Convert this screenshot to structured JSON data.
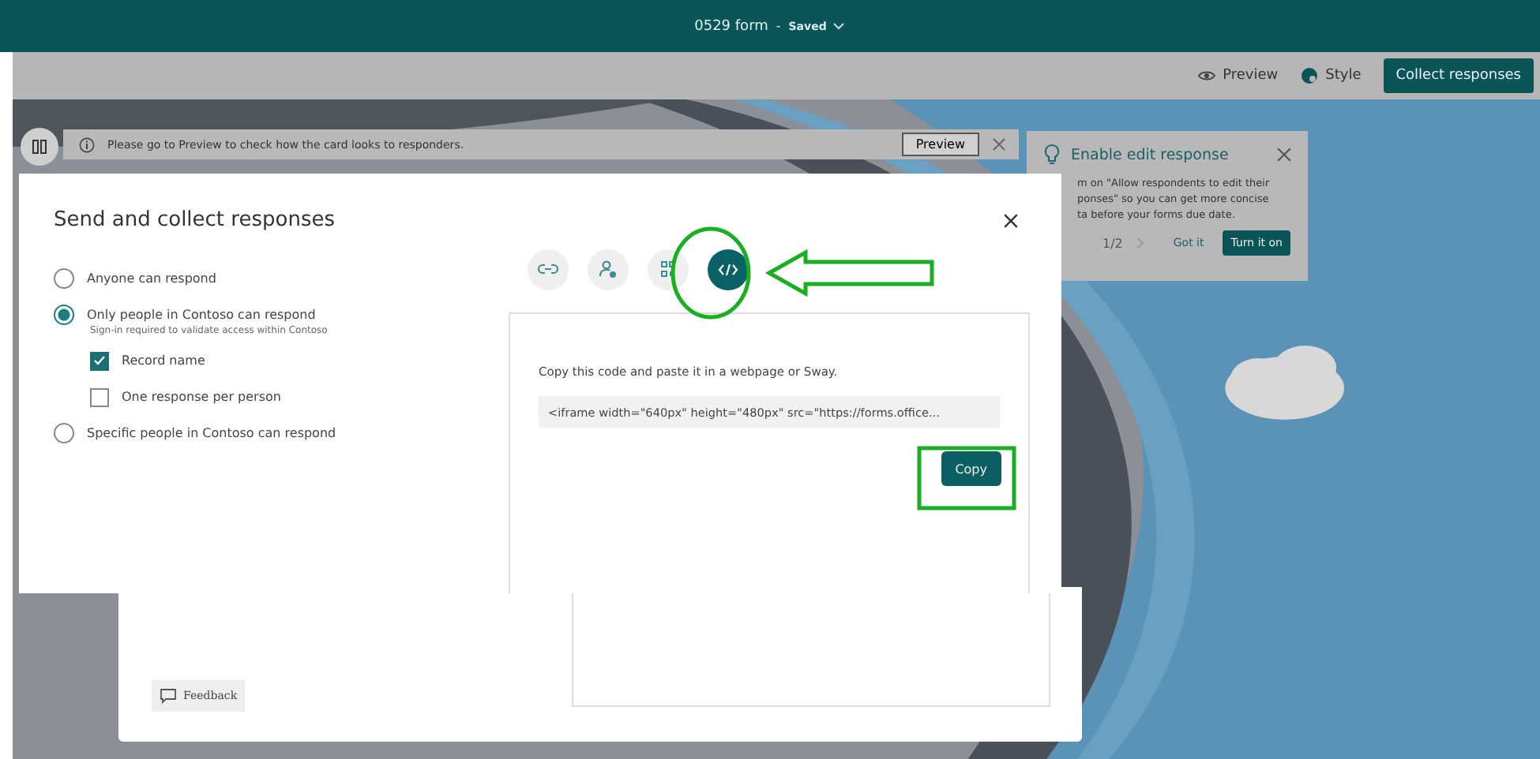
{
  "title_bar": {
    "form_name": "0529 form",
    "separator": "-",
    "status": "Saved"
  },
  "toolbar": {
    "buttons": [
      {
        "label": "Preview",
        "kind": "preview"
      },
      {
        "label": "Style",
        "kind": "style"
      },
      {
        "label": "Collect responses",
        "kind": "primary"
      }
    ]
  },
  "notice_bar": {
    "message": "Please go to Preview to check how the card looks to responders.",
    "button": "Preview"
  },
  "teaching_popup": {
    "title": "Enable edit response",
    "lines": [
      "m on \"Allow respondents to edit their",
      "ponses\" so you can get more concise",
      "ta before your forms due date."
    ],
    "pager": "1/2",
    "secondary": "Got it",
    "primary": "Turn it on"
  },
  "dialog": {
    "title": "Send and collect responses",
    "options": [
      {
        "label": "Anyone can respond",
        "selected": false
      },
      {
        "label": "Only people in Contoso can respond",
        "selected": true,
        "note": "Sign-in required to validate access within Contoso",
        "checkboxes": [
          {
            "label": "Record name",
            "checked": true
          },
          {
            "label": "One response per person",
            "checked": false
          }
        ]
      },
      {
        "label": "Specific people in Contoso can respond",
        "selected": false
      }
    ],
    "share_tabs": [
      {
        "kind": "link",
        "selected": false
      },
      {
        "kind": "people",
        "selected": false
      },
      {
        "kind": "qr",
        "selected": false
      },
      {
        "kind": "embed",
        "selected": true
      }
    ],
    "embed": {
      "instruction": "Copy this code and paste it in a webpage or Sway.",
      "code": "<iframe width=\"640px\" height=\"480px\" src=\"https://forms.office...",
      "button": "Copy"
    }
  },
  "feedback_button": "Feedback"
}
